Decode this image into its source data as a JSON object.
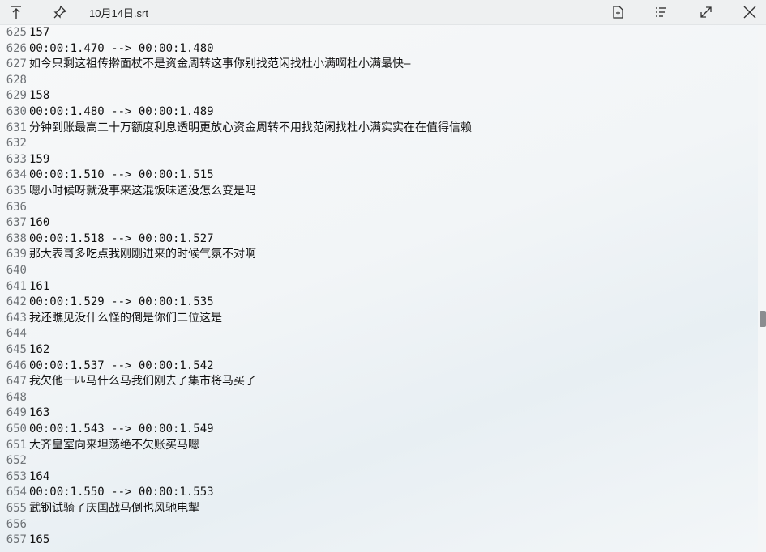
{
  "titlebar": {
    "title": "10月14日.srt",
    "icons": [
      "pin-top-icon",
      "pushpin-icon",
      "save-icon",
      "list-icon",
      "expand-icon",
      "close-icon"
    ]
  },
  "lines": [
    {
      "n": "625",
      "t": "157"
    },
    {
      "n": "626",
      "t": "00:00:1.470 --> 00:00:1.480"
    },
    {
      "n": "627",
      "t": "如今只剩这祖传擀面杖不是资金周转这事你别找范闲找杜小满啊杜小满最快—"
    },
    {
      "n": "628",
      "t": ""
    },
    {
      "n": "629",
      "t": "158"
    },
    {
      "n": "630",
      "t": "00:00:1.480 --> 00:00:1.489"
    },
    {
      "n": "631",
      "t": "分钟到账最高二十万额度利息透明更放心资金周转不用找范闲找杜小满实实在在值得信赖"
    },
    {
      "n": "632",
      "t": ""
    },
    {
      "n": "633",
      "t": "159"
    },
    {
      "n": "634",
      "t": "00:00:1.510 --> 00:00:1.515"
    },
    {
      "n": "635",
      "t": "嗯小时候呀就没事来这混饭味道没怎么变是吗"
    },
    {
      "n": "636",
      "t": ""
    },
    {
      "n": "637",
      "t": "160"
    },
    {
      "n": "638",
      "t": "00:00:1.518 --> 00:00:1.527"
    },
    {
      "n": "639",
      "t": "那大表哥多吃点我刚刚进来的时候气氛不对啊"
    },
    {
      "n": "640",
      "t": ""
    },
    {
      "n": "641",
      "t": "161"
    },
    {
      "n": "642",
      "t": "00:00:1.529 --> 00:00:1.535"
    },
    {
      "n": "643",
      "t": "我还瞧见没什么怪的倒是你们二位这是"
    },
    {
      "n": "644",
      "t": ""
    },
    {
      "n": "645",
      "t": "162"
    },
    {
      "n": "646",
      "t": "00:00:1.537 --> 00:00:1.542"
    },
    {
      "n": "647",
      "t": "我欠他一匹马什么马我们刚去了集市将马买了"
    },
    {
      "n": "648",
      "t": ""
    },
    {
      "n": "649",
      "t": "163"
    },
    {
      "n": "650",
      "t": "00:00:1.543 --> 00:00:1.549"
    },
    {
      "n": "651",
      "t": "大齐皇室向来坦荡绝不欠账买马嗯"
    },
    {
      "n": "652",
      "t": ""
    },
    {
      "n": "653",
      "t": "164"
    },
    {
      "n": "654",
      "t": "00:00:1.550 --> 00:00:1.553"
    },
    {
      "n": "655",
      "t": "武钢试骑了庆国战马倒也风驰电掣"
    },
    {
      "n": "656",
      "t": ""
    },
    {
      "n": "657",
      "t": "165"
    }
  ]
}
